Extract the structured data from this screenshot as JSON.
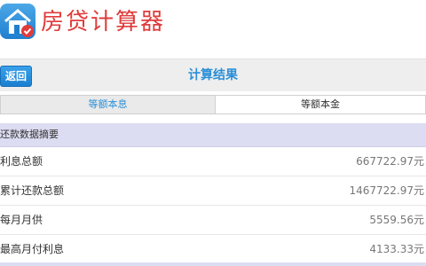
{
  "app": {
    "title": "房贷计算器"
  },
  "navbar": {
    "back_label": "返回",
    "title": "计算结果"
  },
  "tabs": [
    {
      "label": "等额本息",
      "active": true
    },
    {
      "label": "等额本金",
      "active": false
    }
  ],
  "summary": {
    "header": "还款数据摘要",
    "rows": [
      {
        "label": "利息总额",
        "value": "667722.97元"
      },
      {
        "label": "累计还款总额",
        "value": "1467722.97元"
      },
      {
        "label": "每月月供",
        "value": "5559.56元"
      },
      {
        "label": "最高月付利息",
        "value": "4133.33元"
      }
    ]
  },
  "colors": {
    "accent": "#2a8fd8",
    "title_red": "#e03b3b",
    "section_bg": "#dcdcf2"
  },
  "icons": {
    "app": "house-icon",
    "badge": "check-badge-icon"
  }
}
